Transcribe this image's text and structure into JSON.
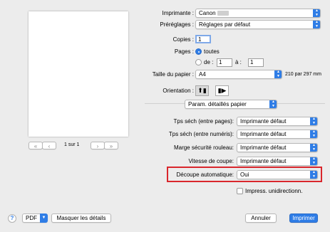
{
  "printer": {
    "label": "Imprimante :",
    "value": "Canon"
  },
  "presets": {
    "label": "Préréglages :",
    "value": "Réglages par défaut"
  },
  "copies": {
    "label": "Copies :",
    "value": "1"
  },
  "pages": {
    "label": "Pages :",
    "all_label": "toutes",
    "from_label": "de :",
    "from_value": "1",
    "to_label": "à :",
    "to_value": "1",
    "selected": "toutes"
  },
  "paper_size": {
    "label": "Taille du papier :",
    "value": "A4",
    "dimensions": "210 par 297 mm"
  },
  "orientation": {
    "label": "Orientation :",
    "selected": "portrait"
  },
  "section": {
    "value": "Param. détaillés papier"
  },
  "settings": [
    {
      "label": "Tps séch (entre pages):",
      "value": "Imprimante défaut"
    },
    {
      "label": "Tps séch (entre numéris):",
      "value": "Imprimante défaut"
    },
    {
      "label": "Marge sécurité rouleau:",
      "value": "Imprimante défaut"
    },
    {
      "label": "Vitesse de coupe:",
      "value": "Imprimante défaut"
    },
    {
      "label": "Découpe automatique:",
      "value": "Oui"
    }
  ],
  "unidirectional": {
    "label": "Impress. unidirectionn.",
    "checked": false
  },
  "preview_nav": {
    "page_info": "1 sur 1",
    "first": "«",
    "prev": "‹",
    "next": "›",
    "last": "»"
  },
  "footer": {
    "help": "?",
    "pdf": "PDF",
    "details": "Masquer les détails",
    "cancel": "Annuler",
    "print": "Imprimer"
  },
  "colors": {
    "accent": "#2f7de6",
    "highlight_border": "#d9262c",
    "background": "#ececec"
  }
}
